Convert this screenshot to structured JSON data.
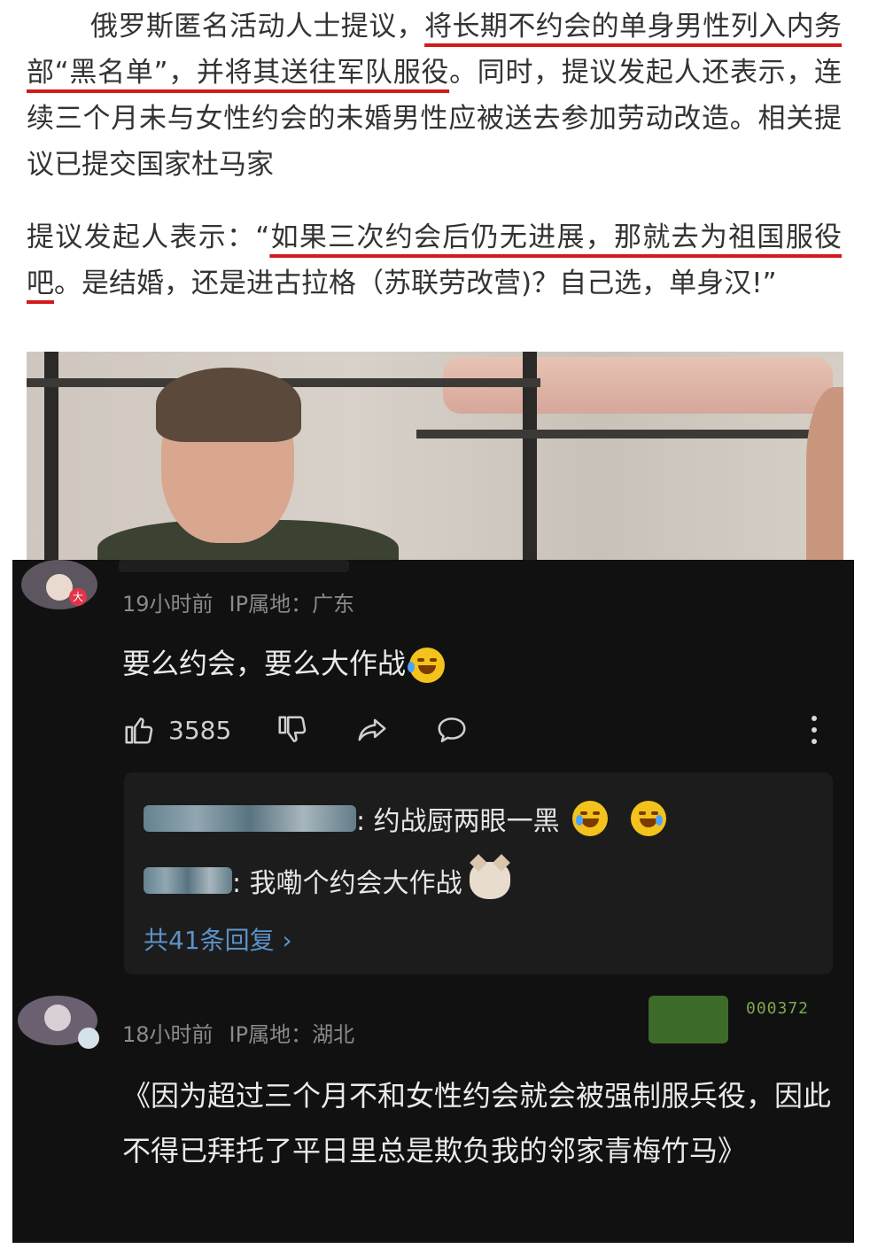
{
  "article": {
    "para1": {
      "a": "俄罗斯匿名活动人士提议，",
      "b": "将长期不约会的单身男性列入内务部“黑名单”，并将其送往军队服役",
      "c": "。同时，提议发起人还表示，连续三个月未与女性约会的未婚男性应被送去参加劳动改造。相关提议已提交国家杜马家"
    },
    "para2": {
      "a": "提议发起人表示：“",
      "b": "如果三次约会后仍无进展，那就去为祖国服役吧",
      "c": "。是结婚，还是进古拉格（苏联劳改营)？自己选，单身汉!”"
    }
  },
  "comment1": {
    "avatar_badge": "大",
    "time": "19小时前",
    "ip": "IP属地：广东",
    "text": "要么约会，要么大作战",
    "like_count": "3585",
    "replies": [
      {
        "text": ": 约战厨两眼一黑"
      },
      {
        "text": ": 我嘞个约会大作战"
      }
    ],
    "more_replies": "共41条回复 ›"
  },
  "comment2": {
    "time": "18小时前",
    "ip": "IP属地：湖北",
    "text": "《因为超过三个月不和女性约会就会被强制服兵役，因此不得已拜托了平日里总是欺负我的邻家青梅竹马》",
    "sticker_number": "000372"
  },
  "colors": {
    "underline": "#d11a1a",
    "comment_bg": "#111111",
    "reply_link": "#5d92c9"
  }
}
